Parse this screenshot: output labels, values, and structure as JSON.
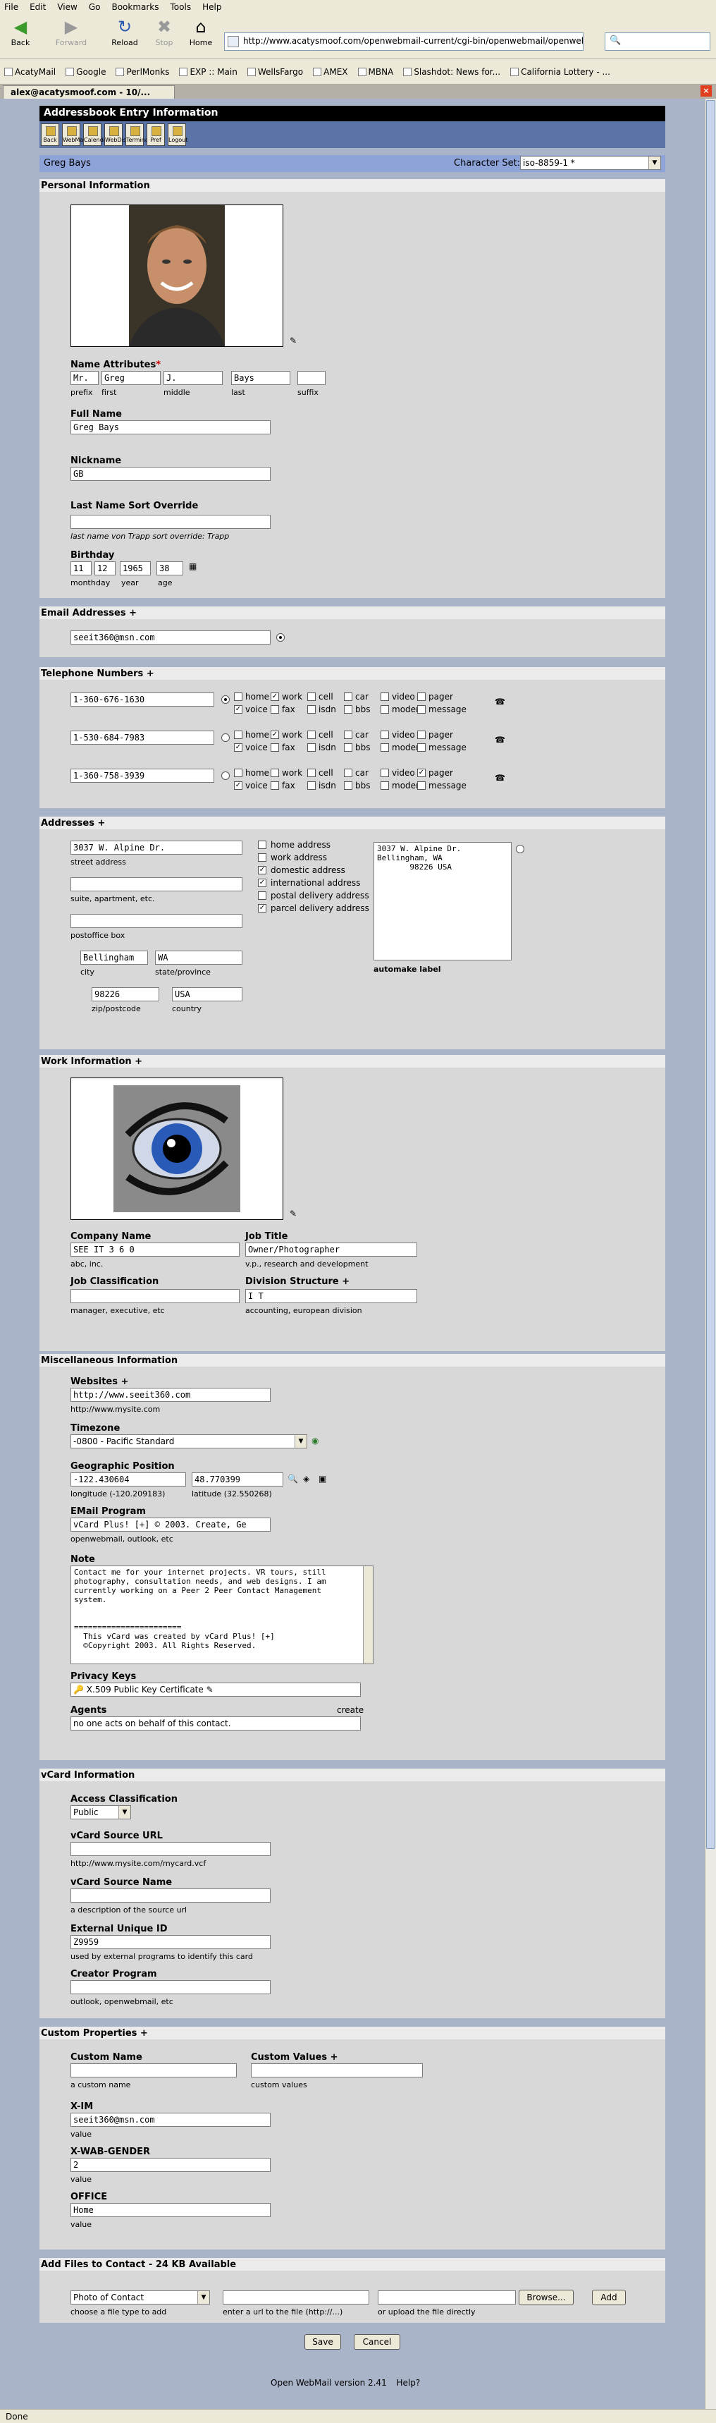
{
  "browser": {
    "menu": [
      "File",
      "Edit",
      "View",
      "Go",
      "Bookmarks",
      "Tools",
      "Help"
    ],
    "nav": {
      "back": "Back",
      "forward": "Forward",
      "reload": "Reload",
      "stop": "Stop",
      "home": "Home"
    },
    "url": "http://www.acatysmoof.com/openwebmail-current/cgi-bin/openwebmail/openwebmail-abook.pl",
    "bookmarks": [
      "AcatyMail",
      "Google",
      "PerlMonks",
      "EXP :: Main",
      "WellsFargo",
      "AMEX",
      "MBNA",
      "Slashdot: News for...",
      "California Lottery - ..."
    ],
    "tab_title": "alex@acatysmoof.com - 10/...",
    "status": "Done"
  },
  "app": {
    "title": "Addressbook Entry Information",
    "icons": [
      "Back",
      "WebMail",
      "Calendar",
      "WebDisk",
      "Terminal",
      "Pref",
      "Logout"
    ],
    "user": "Greg Bays",
    "charset_label": "Character Set:",
    "charset_value": "iso-8859-1 *"
  },
  "personal": {
    "heading": "Personal Information",
    "name_attr_label": "Name Attributes",
    "required": "*",
    "prefix": "Mr.",
    "first": "Greg",
    "middle": "J.",
    "last": "Bays",
    "suffix": "",
    "prefix_h": "prefix",
    "first_h": "first",
    "middle_h": "middle",
    "last_h": "last",
    "suffix_h": "suffix",
    "fullname_label": "Full Name",
    "fullname": "Greg Bays",
    "nickname_label": "Nickname",
    "nickname": "GB",
    "sort_label": "Last Name Sort Override",
    "sort_value": "",
    "sort_hint": "last name von Trapp  sort override: Trapp",
    "birthday_label": "Birthday",
    "month": "11",
    "day": "12",
    "year": "1965",
    "age": "38",
    "month_h": "month",
    "day_h": "day",
    "year_h": "year",
    "age_h": "age"
  },
  "email": {
    "heading": "Email Addresses +",
    "value": "seeit360@msn.com"
  },
  "phones": {
    "heading": "Telephone Numbers +",
    "type_labels": [
      "home",
      "work",
      "cell",
      "car",
      "video",
      "pager",
      "voice",
      "fax",
      "isdn",
      "bbs",
      "modem",
      "message"
    ],
    "rows": [
      {
        "number": "1-360-676-1630",
        "checked": [
          1,
          6
        ]
      },
      {
        "number": "1-530-684-7983",
        "checked": [
          1,
          6
        ]
      },
      {
        "number": "1-360-758-3939",
        "checked": [
          5,
          6
        ]
      }
    ]
  },
  "addresses": {
    "heading": "Addresses +",
    "street": "3037 W. Alpine Dr.",
    "street_h": "street address",
    "suite": "",
    "suite_h": "suite, apartment, etc.",
    "pobox": "",
    "pobox_h": "postoffice box",
    "city": "Bellingham",
    "city_h": "city",
    "state": "WA",
    "state_h": "state/province",
    "zip": "98226",
    "zip_h": "zip/postcode",
    "country": "USA",
    "country_h": "country",
    "types": [
      "home address",
      "work address",
      "domestic address",
      "international address",
      "postal delivery address",
      "parcel delivery address"
    ],
    "types_checked": [
      2,
      3,
      5
    ],
    "label_lines": [
      "3037 W. Alpine Dr.",
      "Bellingham, WA",
      "       98226 USA"
    ],
    "automake": "automake label"
  },
  "work": {
    "heading": "Work Information +",
    "company_label": "Company Name",
    "company": "SEE IT 3 6 0",
    "company_h": "abc, inc.",
    "jobtitle_label": "Job Title",
    "jobtitle": "Owner/Photographer",
    "jobtitle_h": "v.p., research and development",
    "jobclass_label": "Job Classification",
    "jobclass": "",
    "jobclass_h": "manager, executive, etc",
    "division_label": "Division Structure +",
    "division": "I T",
    "division_h": "accounting, european division"
  },
  "misc": {
    "heading": "Miscellaneous Information",
    "websites_label": "Websites +",
    "website": "http://www.seeit360.com",
    "website_h": "http://www.mysite.com",
    "timezone_label": "Timezone",
    "timezone": "-0800 - Pacific Standard",
    "geo_label": "Geographic Position",
    "longitude": "-122.430604",
    "latitude": "48.770399",
    "longitude_h": "longitude  (-120.209183)",
    "latitude_h": "latitude  (32.550268)",
    "emailprog_label": "EMail Program",
    "emailprog": "vCard Plus! [+] © 2003. Create, Ge",
    "emailprog_h": "openwebmail, outlook, etc",
    "note_label": "Note",
    "note_lines": [
      "Contact me for your internet projects. VR tours, still",
      "photography, consultation needs, and web designs. I am",
      "currently working on a Peer 2 Peer Contact Management",
      "system.",
      "",
      "",
      "=======================",
      "  This vCard was created by vCard Plus! [+]",
      "  ©Copyright 2003. All Rights Reserved."
    ],
    "privacy_label": "Privacy Keys",
    "privacy": "X.509 Public Key Certificate",
    "agents_label": "Agents",
    "agents_create": "create",
    "agents": "no one acts on behalf of this contact."
  },
  "vcard": {
    "heading": "vCard Information",
    "access_label": "Access Classification",
    "access": "Public",
    "source_label": "vCard Source URL",
    "source": "",
    "source_h": "http://www.mysite.com/mycard.vcf",
    "sourcename_label": "vCard Source Name",
    "sourcename": "",
    "sourcename_h": "a description of the source url",
    "uid_label": "External Unique ID",
    "uid": "Z9959",
    "uid_h": "used by external programs to identify this card",
    "creator_label": "Creator Program",
    "creator": "",
    "creator_h": "outlook, openwebmail, etc"
  },
  "custom": {
    "heading": "Custom Properties +",
    "name_label": "Custom Name",
    "name_h": "a custom name",
    "values_label": "Custom Values +",
    "values_h": "custom values",
    "xim_label": "X-IM",
    "xim": "seeit360@msn.com",
    "xim_h": "value",
    "xwab_label": "X-WAB-GENDER",
    "xwab": "2",
    "xwab_h": "value",
    "office_label": "OFFICE",
    "office": "Home",
    "office_h": "value"
  },
  "files": {
    "heading": "Add Files to Contact - 24 KB Available",
    "type": "Photo of Contact",
    "type_h": "choose a file type to add",
    "url_h": "enter a url to the file (http://...)",
    "upload_h": "or upload the file directly",
    "browse": "Browse...",
    "add": "Add"
  },
  "actions": {
    "save": "Save",
    "cancel": "Cancel"
  },
  "footer": {
    "version": "Open WebMail version 2.41",
    "help": "Help?"
  }
}
